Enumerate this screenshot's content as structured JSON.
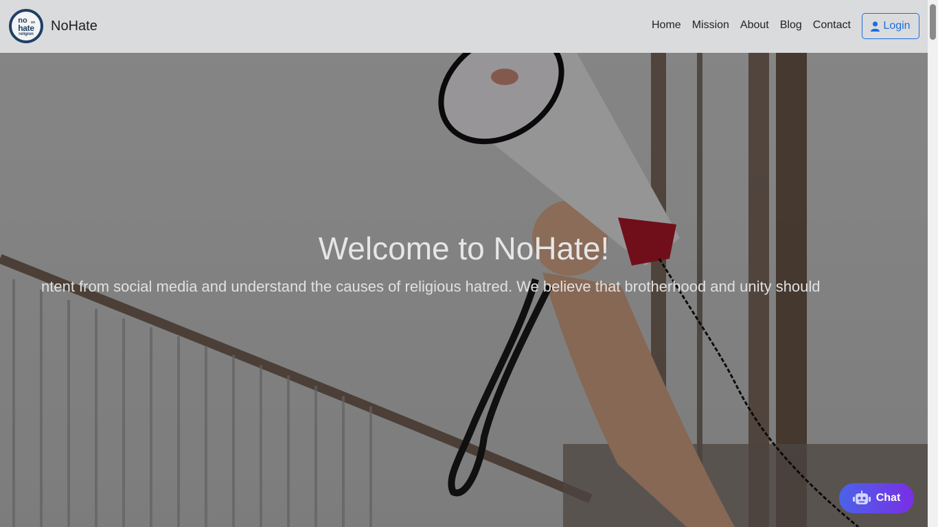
{
  "brand": {
    "name": "NoHate",
    "logo_text": [
      "no",
      "on",
      "hate",
      "religion"
    ]
  },
  "nav": {
    "links": [
      "Home",
      "Mission",
      "About",
      "Blog",
      "Contact"
    ],
    "login_label": "Login"
  },
  "hero": {
    "title": "Welcome to NoHate!",
    "text": "ntent from social media and understand the causes of religious hatred. We believe that brotherhood and unity should"
  },
  "chat": {
    "label": "Chat"
  },
  "colors": {
    "accent": "#1a6de0",
    "logo": "#1f3f66",
    "chat_from": "#4a63e8",
    "chat_to": "#7a2ee6"
  }
}
